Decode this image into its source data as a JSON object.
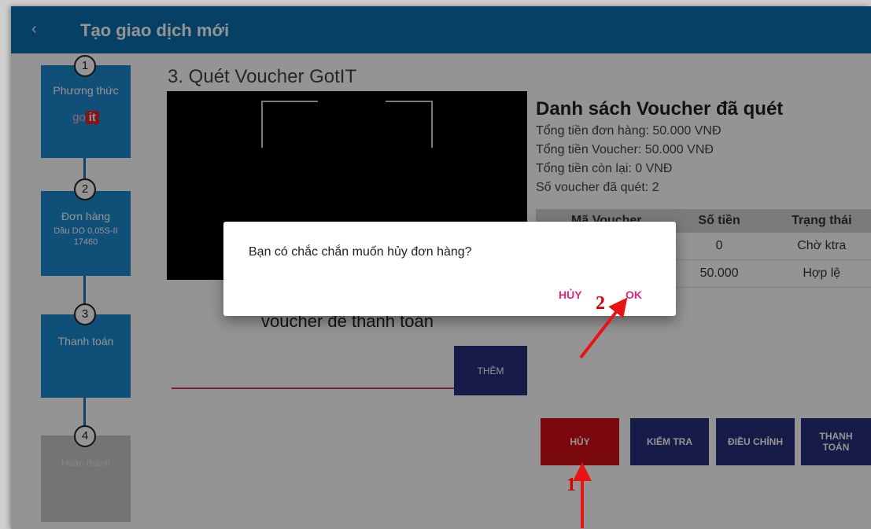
{
  "appbar": {
    "back_icon": "‹",
    "title": "Tạo giao dịch mới"
  },
  "steps": [
    {
      "num": "1",
      "title": "Phương thức",
      "logo": "got it"
    },
    {
      "num": "2",
      "title": "Đơn hàng",
      "sub1": "Dầu DO 0,05S-II",
      "sub2": "17460"
    },
    {
      "num": "3",
      "title": "Thanh toán"
    },
    {
      "num": "4",
      "title": "Hoàn thành"
    }
  ],
  "scan": {
    "title": "3. Quét Voucher GotIT",
    "hint": "voucher để thanh toán",
    "input_value": "",
    "add_label": "THÊM"
  },
  "voucher_list": {
    "title": "Danh sách Voucher đã quét",
    "order_total": "Tổng tiền đơn hàng: 50.000  VNĐ",
    "voucher_total": "Tổng tiền Voucher: 50.000  VNĐ",
    "remaining": "Tổng tiền còn lại: 0  VNĐ",
    "count": "Số voucher đã quét: 2",
    "columns": [
      "Mã Voucher",
      "Số tiền",
      "Trạng thái"
    ],
    "rows": [
      {
        "code": "",
        "amount": "0",
        "status": "Chờ ktra"
      },
      {
        "code": "",
        "amount": "50.000",
        "status": "Hợp lệ"
      }
    ]
  },
  "actions": {
    "cancel": "HỦY",
    "check": "KIỂM TRA",
    "adjust": "ĐIỀU CHỈNH",
    "pay": "THANH TOÁN"
  },
  "dialog": {
    "message": "Bạn có chắc chắn muốn hủy đơn hàng?",
    "cancel": "HỦY",
    "ok": "OK"
  },
  "annotations": {
    "step1": "1",
    "step2": "2"
  },
  "colors": {
    "appbar": "#0d6fae",
    "step_active": "#1a88cf",
    "button_navy": "#27307d",
    "button_red": "#d50f17",
    "dialog_accent": "#e6247a",
    "annotation": "#d40000"
  }
}
